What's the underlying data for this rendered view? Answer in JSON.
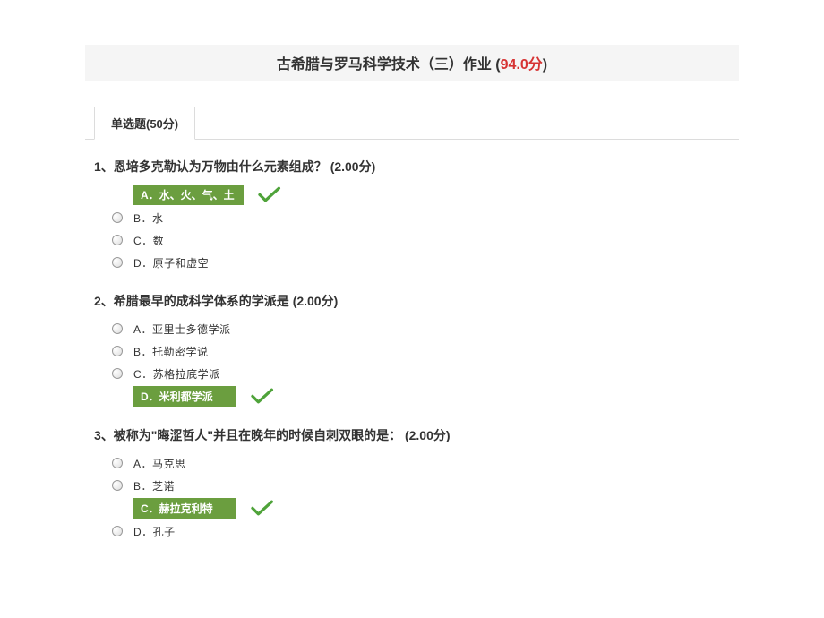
{
  "header": {
    "title_prefix": "古希腊与罗马科学技术（三）作业  (",
    "score": "94.0分",
    "title_suffix": ")"
  },
  "tab": {
    "label": "单选题(50分)"
  },
  "questions": [
    {
      "num": "1、",
      "text": "恩培多克勒认为万物由什么元素组成？",
      "points": "(2.00分)",
      "correct_index": 0,
      "options": [
        {
          "letter": "A．",
          "text": "水、火、气、土"
        },
        {
          "letter": "B．",
          "text": "水"
        },
        {
          "letter": "C．",
          "text": "数"
        },
        {
          "letter": "D．",
          "text": "原子和虚空"
        }
      ]
    },
    {
      "num": "2、",
      "text": "希腊最早的成科学体系的学派是",
      "points": "(2.00分)",
      "correct_index": 3,
      "options": [
        {
          "letter": "A．",
          "text": "亚里士多德学派"
        },
        {
          "letter": "B．",
          "text": "托勒密学说"
        },
        {
          "letter": "C．",
          "text": "苏格拉底学派"
        },
        {
          "letter": "D．",
          "text": "米利都学派"
        }
      ]
    },
    {
      "num": "3、",
      "text": "被称为\"晦涩哲人\"并且在晚年的时候自刺双眼的是：",
      "points": "(2.00分)",
      "correct_index": 2,
      "options": [
        {
          "letter": "A．",
          "text": "马克思"
        },
        {
          "letter": "B．",
          "text": "芝诺"
        },
        {
          "letter": "C．",
          "text": "赫拉克利特"
        },
        {
          "letter": "D．",
          "text": "孔子"
        }
      ]
    }
  ]
}
